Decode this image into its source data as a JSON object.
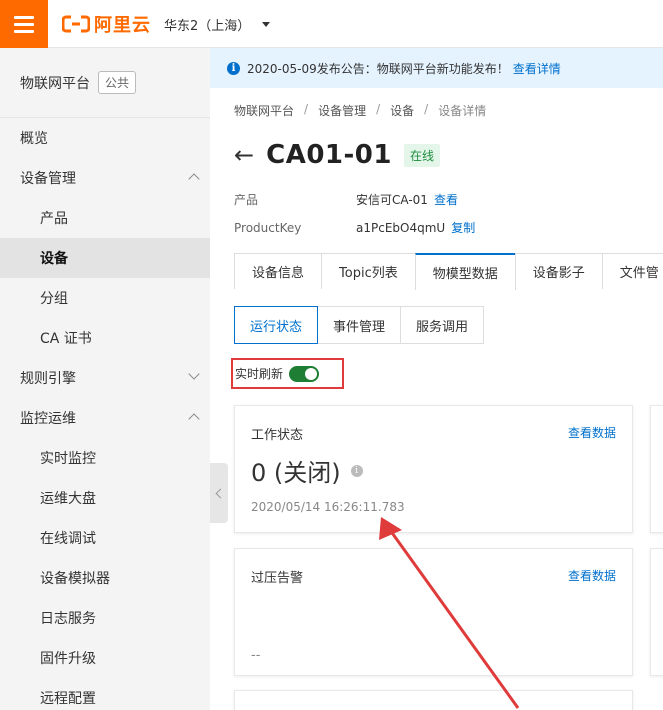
{
  "brand": {
    "name": "阿里云",
    "color": "#ff6a00"
  },
  "region": "华东2（上海）",
  "sidebar": {
    "title": "物联网平台",
    "badge": "公共",
    "items": [
      {
        "label": "概览"
      },
      {
        "label": "设备管理",
        "expanded": true
      },
      {
        "label": "产品"
      },
      {
        "label": "设备",
        "active": true
      },
      {
        "label": "分组"
      },
      {
        "label": "CA 证书"
      },
      {
        "label": "规则引擎",
        "expanded": false
      },
      {
        "label": "监控运维",
        "expanded": true
      },
      {
        "label": "实时监控"
      },
      {
        "label": "运维大盘"
      },
      {
        "label": "在线调试"
      },
      {
        "label": "设备模拟器"
      },
      {
        "label": "日志服务"
      },
      {
        "label": "固件升级"
      },
      {
        "label": "远程配置"
      }
    ]
  },
  "notice": {
    "text": "2020-05-09发布公告：物联网平台新功能发布！",
    "link": "查看详情"
  },
  "breadcrumb": [
    "物联网平台",
    "设备管理",
    "设备",
    "设备详情"
  ],
  "breadcrumb_sep": "/",
  "device": {
    "back": "←",
    "name": "CA01-01",
    "status": "在线",
    "product_label": "产品",
    "product_value": "安信可CA-01",
    "product_link": "查看",
    "key_label": "ProductKey",
    "key_value": "a1PcEbO4qmU",
    "key_link": "复制"
  },
  "tabs": [
    "设备信息",
    "Topic列表",
    "物模型数据",
    "设备影子",
    "文件管"
  ],
  "active_tab": "物模型数据",
  "subtabs": [
    "运行状态",
    "事件管理",
    "服务调用"
  ],
  "realtime_label": "实时刷新",
  "realtime_on": true,
  "cards": [
    {
      "title": "工作状态",
      "link": "查看数据",
      "value": "0 (关闭)",
      "info": "i",
      "time": "2020/05/14 16:26:11.783"
    },
    {
      "title": "过压告警",
      "link": "查看数据",
      "value": "--"
    }
  ],
  "colors": {
    "accent": "#0070cc",
    "highlight": "#e03b3b",
    "online": "#1e8e3e"
  }
}
